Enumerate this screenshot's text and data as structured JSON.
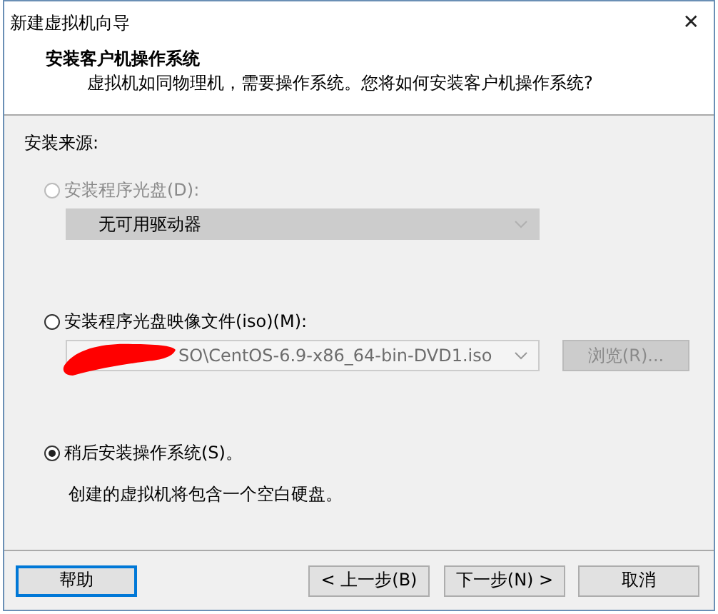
{
  "window": {
    "title": "新建虚拟机向导",
    "close": "✕"
  },
  "header": {
    "title": "安装客户机操作系统",
    "subtitle": "虚拟机如同物理机，需要操作系统。您将如何安装客户机操作系统?"
  },
  "source_label": "安装来源:",
  "options": [
    {
      "kind": "drive",
      "label": "安装程序光盘(D):",
      "selected": false,
      "disabled": true,
      "value": "无可用驱动器"
    },
    {
      "kind": "iso",
      "label": "安装程序光盘映像文件(iso)(M):",
      "selected": false,
      "disabled": false,
      "value": "SO\\CentOS-6.9-x86_64-bin-DVD1.iso",
      "redacted": true,
      "browse": "浏览(R)..."
    },
    {
      "kind": "later",
      "label": "稍后安装操作系统(S)。",
      "selected": true,
      "disabled": false,
      "note": "创建的虚拟机将包含一个空白硬盘。"
    }
  ],
  "buttons": [
    {
      "label": "帮助",
      "default": true
    },
    {
      "label": "< 上一步(B)",
      "default": false
    },
    {
      "label": "下一步(N) >",
      "default": false
    },
    {
      "label": "取消",
      "default": false
    }
  ]
}
